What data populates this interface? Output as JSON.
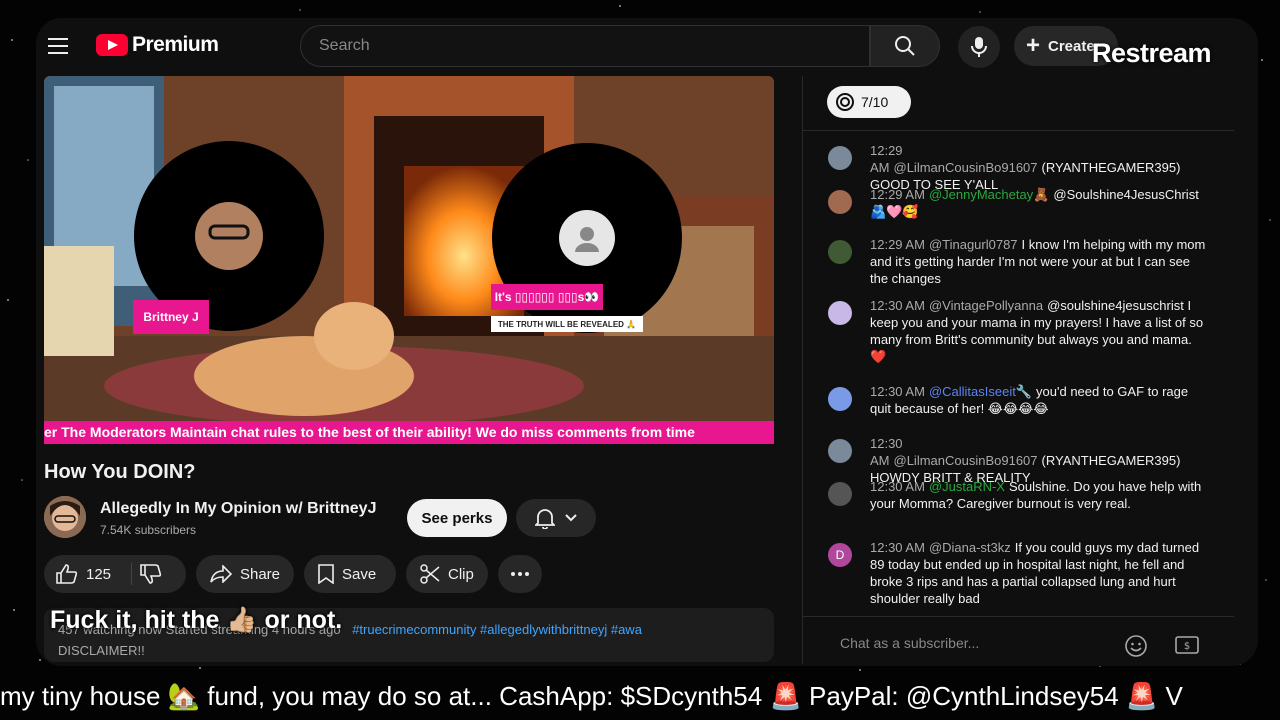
{
  "header": {
    "brand": "Premium",
    "search_placeholder": "Search",
    "create_label": "Create",
    "restream_label": "Restream"
  },
  "video": {
    "guest_name": "Brittney J",
    "banner_main": "It's ▯▯▯▯▯▯ ▯▯▯s👀",
    "banner_sub": "THE TRUTH WILL BE REVEALED 🙏",
    "ticker": "er The Moderators Maintain chat rules to the best of their ability! We do miss comments from time"
  },
  "meta": {
    "title": "How You DOIN?",
    "channel_name": "Allegedly In My Opinion w/ BrittneyJ",
    "subscribers": "7.54K subscribers",
    "perks_label": "See perks",
    "like_count": "125",
    "share_label": "Share",
    "save_label": "Save",
    "clip_label": "Clip",
    "desc_line1": "457 watching now  Started streaming 4 hours ago",
    "desc_tags": "#truecrimecommunity #allegedlywithbrittneyj #awa",
    "desc_line2": "DISCLAIMER!!",
    "overlay_caption": "Fuck it, hit the 👍🏼 or not."
  },
  "chat": {
    "goal": "7/10",
    "messages": [
      {
        "time": "12:29 AM",
        "author": "@LilmanCousinBo91607",
        "text": "(RYANTHEGAMER395) GOOD TO SEE Y'ALL",
        "kind": "normal",
        "avatar_color": "#7a8a9a"
      },
      {
        "time": "12:29 AM",
        "author": "@JennyMachetay🧸",
        "text": "@Soulshine4JesusChrist 🫂🩷🥰",
        "kind": "mem",
        "avatar_color": "#a06a50"
      },
      {
        "time": "12:29 AM",
        "author": "@Tinagurl0787",
        "text": "I know I'm helping with my mom and it's getting harder I'm not were your at but I can see the changes",
        "kind": "normal",
        "avatar_color": "#3f5a35"
      },
      {
        "time": "12:30 AM",
        "author": "@VintagePollyanna",
        "text": "@soulshine4jesuschrist I keep you and your mama in my prayers! I have a list of so many from Britt's community but always you and mama. ❤️",
        "kind": "normal",
        "avatar_color": "#c8b8e8"
      },
      {
        "time": "12:30 AM",
        "author": "@CallitasIseeit🔧",
        "text": "you'd need to GAF to rage quit because of her! 😂😂😂😂",
        "kind": "mod",
        "avatar_color": "#7a9ae8"
      },
      {
        "time": "12:30 AM",
        "author": "@LilmanCousinBo91607",
        "text": "(RYANTHEGAMER395) HOWDY BRITT & REALITY",
        "kind": "normal",
        "avatar_color": "#7a8a9a"
      },
      {
        "time": "12:30 AM",
        "author": "@JustaRN-X",
        "text": "Soulshine. Do you have help with your Momma? Caregiver burnout is very real.",
        "kind": "mem",
        "avatar_color": "#555"
      },
      {
        "time": "12:30 AM",
        "author": "@Diana-st3kz",
        "text": "If you could guys my dad turned 89 today but ended up in hospital last night, he fell and broke 3 rips and has a partial collapsed lung and hurt shoulder really bad",
        "kind": "normal",
        "avatar_color": "#b0479d",
        "initial": "D"
      }
    ],
    "input_placeholder": "Chat as a subscriber..."
  },
  "bottom_ticker": "my tiny house 🏡 fund, you may do so at... CashApp: $SDcynth54 🚨 PayPal: @CynthLindsey54 🚨 V"
}
